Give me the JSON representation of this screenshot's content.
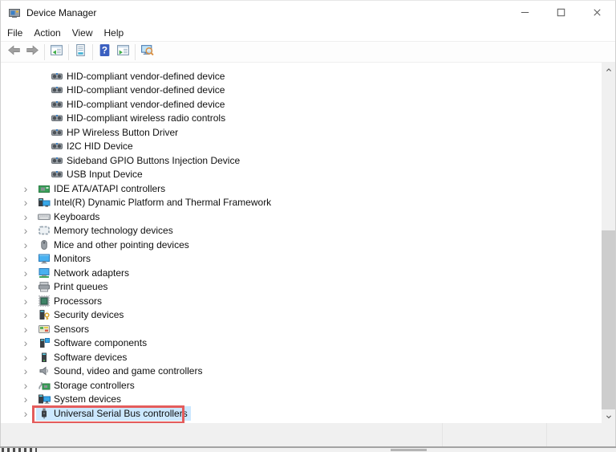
{
  "window": {
    "title": "Device Manager",
    "title_icon": "device-manager-icon",
    "controls": [
      {
        "name": "minimize-button",
        "icon": "minimize-icon"
      },
      {
        "name": "maximize-button",
        "icon": "maximize-icon"
      },
      {
        "name": "close-button",
        "icon": "close-icon"
      }
    ]
  },
  "menu": {
    "items": [
      {
        "label": "File"
      },
      {
        "label": "Action"
      },
      {
        "label": "View"
      },
      {
        "label": "Help"
      }
    ]
  },
  "toolbar": {
    "buttons": [
      {
        "name": "back-button",
        "icon": "back-arrow"
      },
      {
        "name": "forward-button",
        "icon": "forward-arrow"
      },
      {
        "sep": true
      },
      {
        "name": "show-console-tree-button",
        "icon": "show-console-tree"
      },
      {
        "sep": true
      },
      {
        "name": "properties-button",
        "icon": "properties"
      },
      {
        "sep": true
      },
      {
        "name": "help-button",
        "icon": "help",
        "glyph": "?"
      },
      {
        "name": "action-pane-button",
        "icon": "action-pane"
      },
      {
        "sep": true
      },
      {
        "name": "scan-hardware-button",
        "icon": "scan-hardware"
      }
    ]
  },
  "tree": {
    "chevron_glyph": "›",
    "items": [
      {
        "label": "HID-compliant vendor-defined device",
        "icon": "hid-device",
        "level": 2
      },
      {
        "label": "HID-compliant vendor-defined device",
        "icon": "hid-device",
        "level": 2
      },
      {
        "label": "HID-compliant vendor-defined device",
        "icon": "hid-device",
        "level": 2
      },
      {
        "label": "HID-compliant wireless radio controls",
        "icon": "hid-device",
        "level": 2
      },
      {
        "label": "HP Wireless Button Driver",
        "icon": "hid-device",
        "level": 2
      },
      {
        "label": "I2C HID Device",
        "icon": "hid-device",
        "level": 2
      },
      {
        "label": "Sideband GPIO Buttons Injection Device",
        "icon": "hid-device",
        "level": 2
      },
      {
        "label": "USB Input Device",
        "icon": "hid-device",
        "level": 2
      },
      {
        "label": "IDE ATA/ATAPI controllers",
        "icon": "ide-controller",
        "level": 1,
        "chevron": true
      },
      {
        "label": "Intel(R) Dynamic Platform and Thermal Framework",
        "icon": "thermal-framework",
        "level": 1,
        "chevron": true
      },
      {
        "label": "Keyboards",
        "icon": "keyboard",
        "level": 1,
        "chevron": true
      },
      {
        "label": "Memory technology devices",
        "icon": "memory-card",
        "level": 1,
        "chevron": true
      },
      {
        "label": "Mice and other pointing devices",
        "icon": "mouse",
        "level": 1,
        "chevron": true
      },
      {
        "label": "Monitors",
        "icon": "monitor",
        "level": 1,
        "chevron": true
      },
      {
        "label": "Network adapters",
        "icon": "network-adapter",
        "level": 1,
        "chevron": true
      },
      {
        "label": "Print queues",
        "icon": "printer",
        "level": 1,
        "chevron": true
      },
      {
        "label": "Processors",
        "icon": "processor",
        "level": 1,
        "chevron": true
      },
      {
        "label": "Security devices",
        "icon": "security-device",
        "level": 1,
        "chevron": true
      },
      {
        "label": "Sensors",
        "icon": "sensor",
        "level": 1,
        "chevron": true
      },
      {
        "label": "Software components",
        "icon": "software-component",
        "level": 1,
        "chevron": true
      },
      {
        "label": "Software devices",
        "icon": "software-device",
        "level": 1,
        "chevron": true
      },
      {
        "label": "Sound, video and game controllers",
        "icon": "speaker",
        "level": 1,
        "chevron": true
      },
      {
        "label": "Storage controllers",
        "icon": "storage-controller",
        "level": 1,
        "chevron": true
      },
      {
        "label": "System devices",
        "icon": "system-device",
        "level": 1,
        "chevron": true
      },
      {
        "label": "Universal Serial Bus controllers",
        "icon": "usb-controller",
        "level": 1,
        "chevron": true,
        "selected": true,
        "annotated": true
      }
    ]
  },
  "colors": {
    "selection_background": "#cce8ff",
    "annotation_border": "#e45c5c",
    "scrollbar_track": "#f0f0f0",
    "scrollbar_thumb": "#cdcdcd",
    "statusbar_background": "#f0f0f0"
  }
}
